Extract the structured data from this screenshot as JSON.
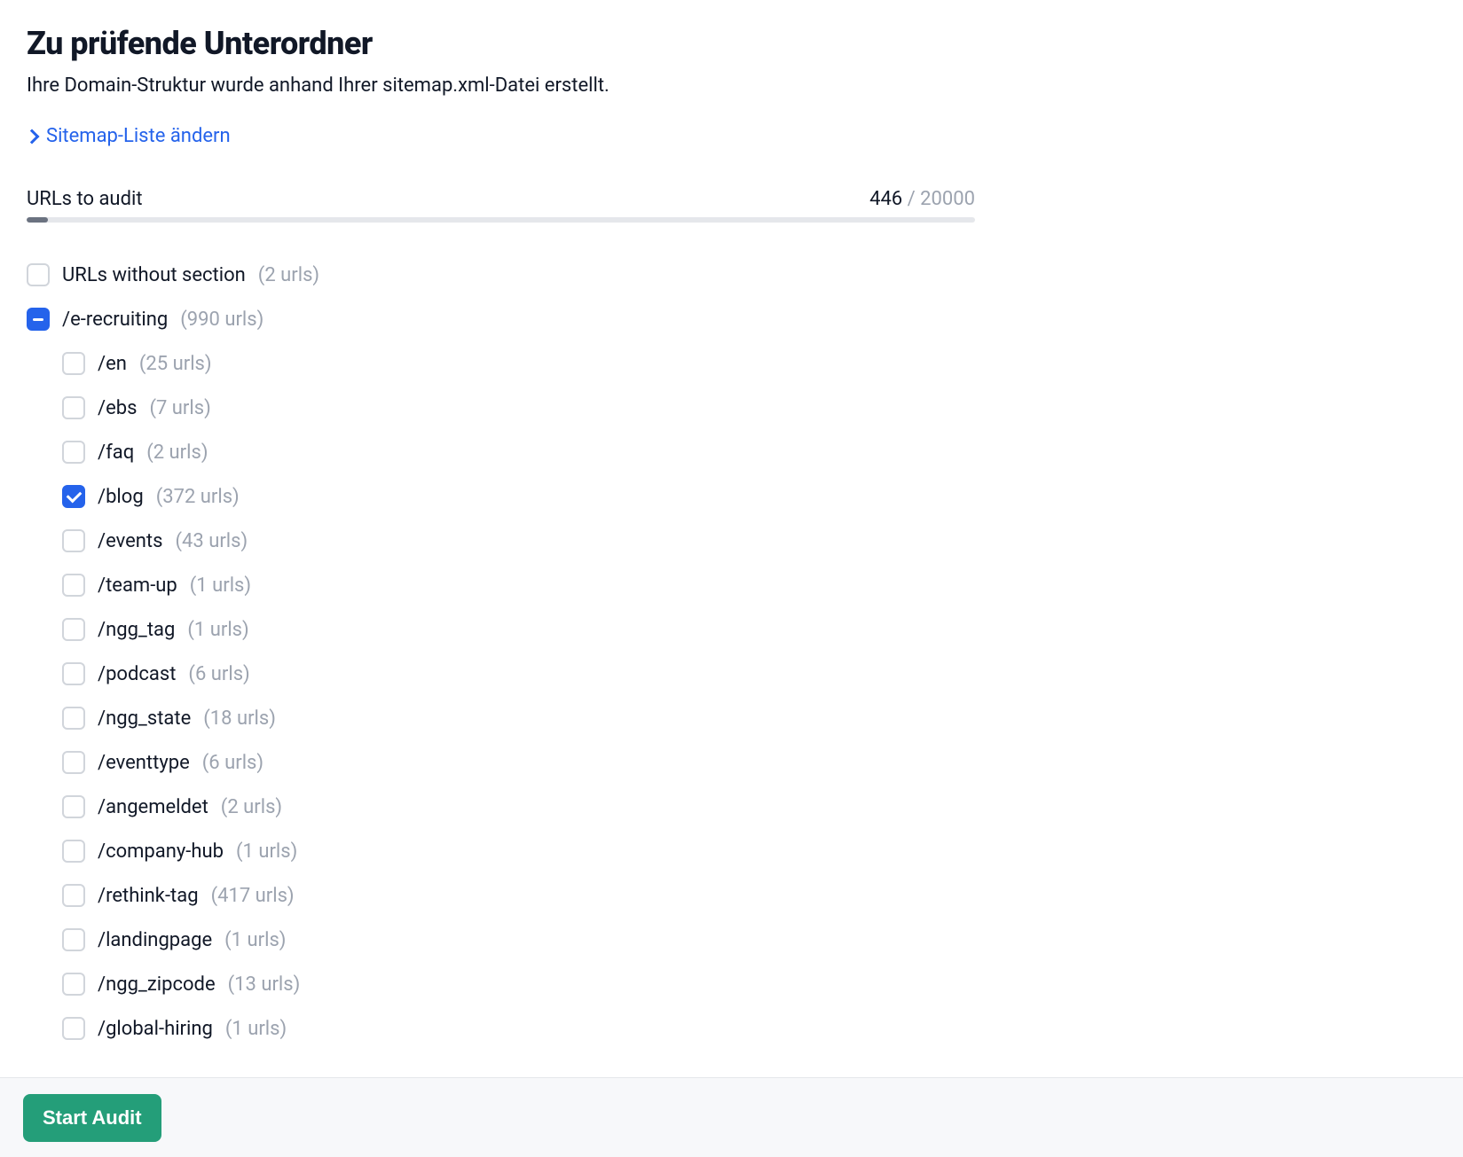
{
  "title": "Zu prüfende Unterordner",
  "subtitle": "Ihre Domain-Struktur wurde anhand Ihrer sitemap.xml-Datei erstellt.",
  "sitemapLinkLabel": "Sitemap-Liste ändern",
  "audit": {
    "label": "URLs to audit",
    "used": "446",
    "separator": " / ",
    "limit": "20000",
    "percent": 2.23
  },
  "tree": {
    "root": {
      "label": "URLs without section",
      "count": "(2 urls)",
      "state": "unchecked"
    },
    "main": {
      "label": "/e-recruiting",
      "count": "(990 urls)",
      "state": "indeterminate",
      "children": [
        {
          "label": "/en",
          "count": "(25 urls)",
          "state": "unchecked"
        },
        {
          "label": "/ebs",
          "count": "(7 urls)",
          "state": "unchecked"
        },
        {
          "label": "/faq",
          "count": "(2 urls)",
          "state": "unchecked"
        },
        {
          "label": "/blog",
          "count": "(372 urls)",
          "state": "checked"
        },
        {
          "label": "/events",
          "count": "(43 urls)",
          "state": "unchecked"
        },
        {
          "label": "/team-up",
          "count": "(1 urls)",
          "state": "unchecked"
        },
        {
          "label": "/ngg_tag",
          "count": "(1 urls)",
          "state": "unchecked"
        },
        {
          "label": "/podcast",
          "count": "(6 urls)",
          "state": "unchecked"
        },
        {
          "label": "/ngg_state",
          "count": "(18 urls)",
          "state": "unchecked"
        },
        {
          "label": "/eventtype",
          "count": "(6 urls)",
          "state": "unchecked"
        },
        {
          "label": "/angemeldet",
          "count": "(2 urls)",
          "state": "unchecked"
        },
        {
          "label": "/company-hub",
          "count": "(1 urls)",
          "state": "unchecked"
        },
        {
          "label": "/rethink-tag",
          "count": "(417 urls)",
          "state": "unchecked"
        },
        {
          "label": "/landingpage",
          "count": "(1 urls)",
          "state": "unchecked"
        },
        {
          "label": "/ngg_zipcode",
          "count": "(13 urls)",
          "state": "unchecked"
        },
        {
          "label": "/global-hiring",
          "count": "(1 urls)",
          "state": "unchecked"
        }
      ]
    }
  },
  "footer": {
    "startLabel": "Start Audit"
  }
}
